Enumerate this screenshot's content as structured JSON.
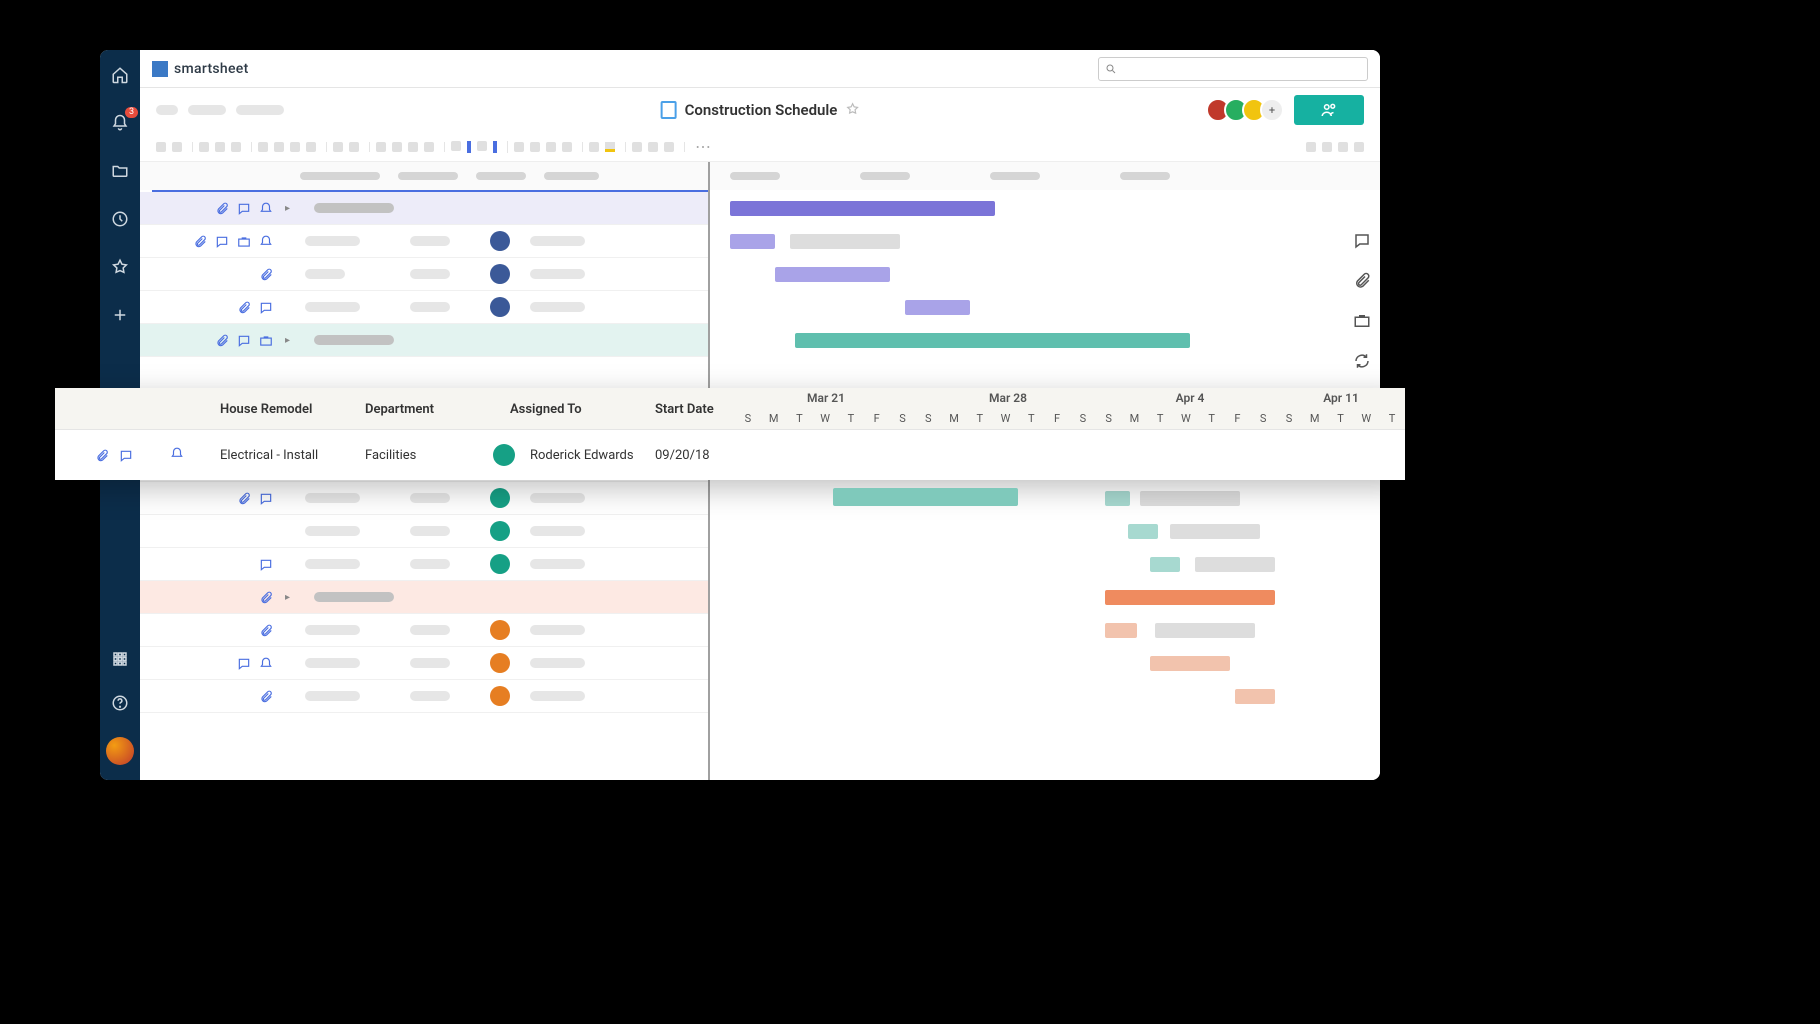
{
  "app": {
    "brand": "smartsheet"
  },
  "nav": {
    "notifications_count": "3",
    "icons": [
      "home",
      "bell",
      "folder",
      "clock",
      "star",
      "plus"
    ],
    "bottom_icons": [
      "apps",
      "help"
    ]
  },
  "search": {
    "placeholder": ""
  },
  "document": {
    "title": "Construction Schedule"
  },
  "collaborators_plus": "+",
  "popout": {
    "columns": {
      "task": "House Remodel",
      "department": "Department",
      "assigned": "Assigned To",
      "start": "Start Date"
    },
    "row": {
      "task": "Electrical - Install",
      "department": "Facilities",
      "assigned": "Roderick Edwards",
      "start": "09/20/18"
    },
    "timeline": {
      "weeks": [
        "Mar 21",
        "Mar 28",
        "Apr 4",
        "Apr 11"
      ],
      "days": [
        "S",
        "M",
        "T",
        "W",
        "T",
        "F",
        "S",
        "S",
        "M",
        "T",
        "W",
        "T",
        "F",
        "S",
        "S",
        "M",
        "T",
        "W",
        "T",
        "F",
        "S",
        "S",
        "M",
        "T",
        "W",
        "T"
      ]
    }
  },
  "colors": {
    "purple": "#7b74d8",
    "teal": "#5fbfae",
    "orange": "#ef8b5f",
    "nav_bg": "#0c2d4a",
    "accent_teal": "#16b1a1"
  }
}
